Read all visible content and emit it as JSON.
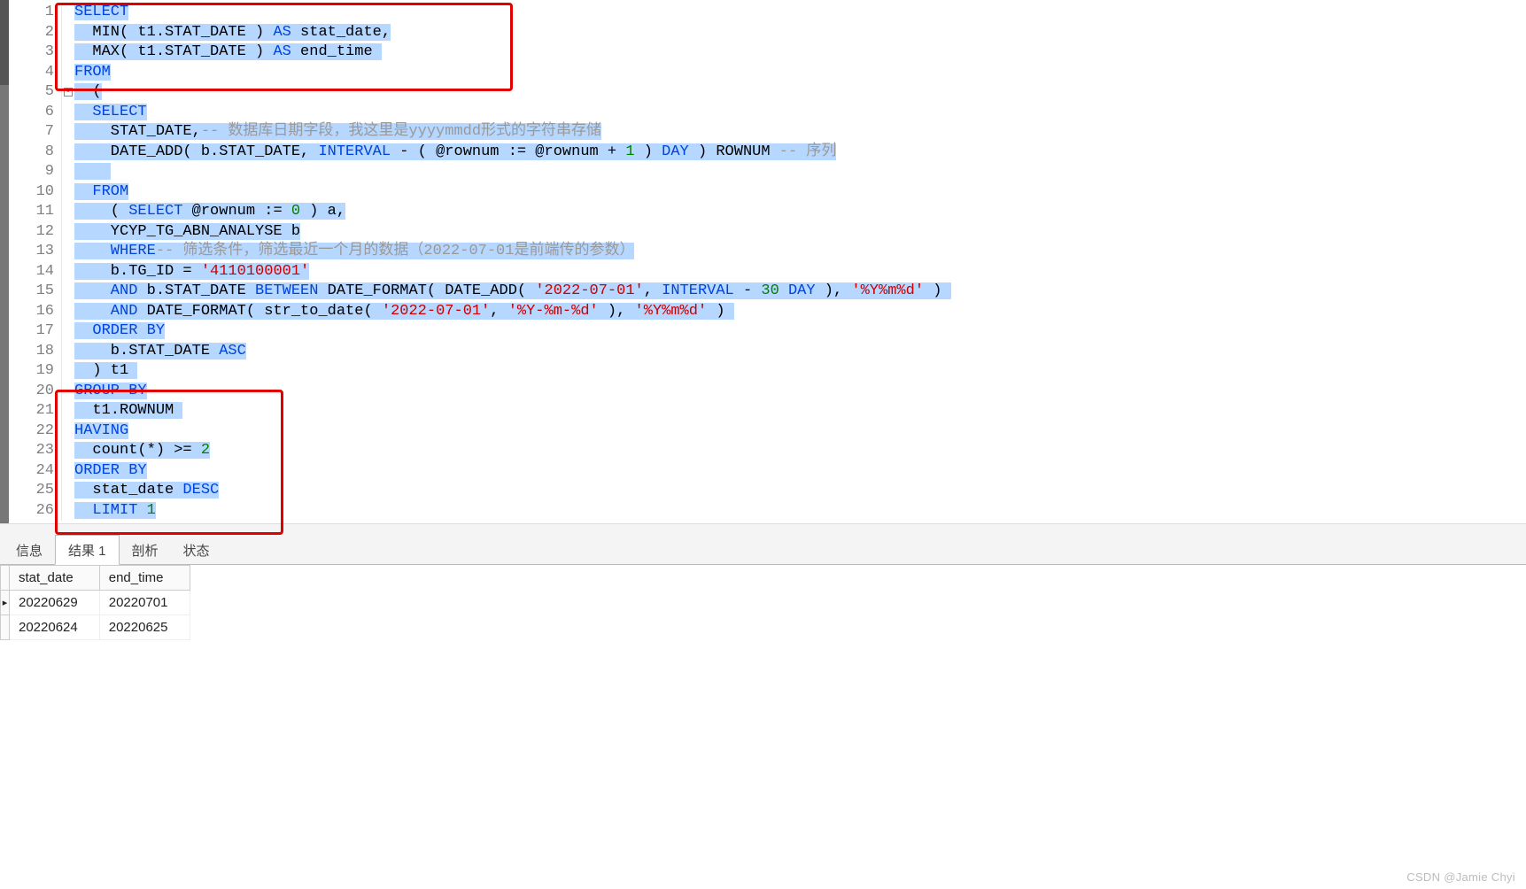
{
  "code": {
    "lines": [
      1,
      2,
      3,
      4,
      5,
      6,
      7,
      8,
      9,
      10,
      11,
      12,
      13,
      14,
      15,
      16,
      17,
      18,
      19,
      20,
      21,
      22,
      23,
      24,
      25,
      26
    ],
    "l1_k": "SELECT",
    "l2_p1": "  MIN( t1.STAT_DATE ) ",
    "l2_k": "AS",
    "l2_p2": " stat_date,",
    "l3_p1": "  MAX( t1.STAT_DATE ) ",
    "l3_k": "AS",
    "l3_p2": " end_time ",
    "l4_k": "FROM",
    "l5_p": "  (",
    "l6_k": "  SELECT",
    "l7_p1": "    STAT_DATE,",
    "l7_cm": "-- 数据库日期字段，我这里是yyyymmdd形式的字符串存储",
    "l8_p1": "    DATE_ADD( b.STAT_DATE, ",
    "l8_k1": "INTERVAL",
    "l8_p2": " - ( @rownum := @rownum + ",
    "l8_n1": "1",
    "l8_p3": " ) ",
    "l8_k2": "DAY",
    "l8_p4": " ) ROWNUM ",
    "l8_cm": "-- 序列",
    "l9_p": "    ",
    "l10_k": "  FROM",
    "l11_p1": "    ( ",
    "l11_k": "SELECT",
    "l11_p2": " @rownum := ",
    "l11_n": "0",
    "l11_p3": " ) a,",
    "l12_p": "    YCYP_TG_ABN_ANALYSE b",
    "l13_k": "    WHERE",
    "l13_cm": "-- 筛选条件，筛选最近一个月的数据（2022-07-01是前端传的参数）",
    "l14_p1": "    b.TG_ID = ",
    "l14_s": "'4110100001'",
    "l15_k1": "    AND",
    "l15_p1": " b.STAT_DATE ",
    "l15_k2": "BETWEEN",
    "l15_p2": " DATE_FORMAT( DATE_ADD( ",
    "l15_s1": "'2022-07-01'",
    "l15_p3": ", ",
    "l15_k3": "INTERVAL",
    "l15_p4": " - ",
    "l15_n": "30",
    "l15_k4": " DAY",
    "l15_p5": " ), ",
    "l15_s2": "'%Y%m%d'",
    "l15_p6": " ) ",
    "l16_k1": "    AND",
    "l16_p1": " DATE_FORMAT( str_to_date( ",
    "l16_s1": "'2022-07-01'",
    "l16_p2": ", ",
    "l16_s2": "'%Y-%m-%d'",
    "l16_p3": " ), ",
    "l16_s3": "'%Y%m%d'",
    "l16_p4": " ) ",
    "l17_k": "  ORDER BY",
    "l18_p1": "    b.STAT_DATE ",
    "l18_k": "ASC",
    "l19_p": "  ) t1 ",
    "l20_k": "GROUP BY",
    "l21_p": "  t1.ROWNUM ",
    "l22_k": "HAVING",
    "l23_p1": "  count(*) >= ",
    "l23_n": "2",
    "l24_k": "ORDER BY",
    "l25_p1": "  stat_date ",
    "l25_k": "DESC",
    "l26_k1": "  LIMIT",
    "l26_p": " ",
    "l26_n": "1"
  },
  "tabs": {
    "info": "信息",
    "result": "结果 1",
    "profile": "剖析",
    "status": "状态"
  },
  "results": {
    "headers": {
      "c0": "stat_date",
      "c1": "end_time"
    },
    "rows": [
      {
        "c0": "20220629",
        "c1": "20220701"
      },
      {
        "c0": "20220624",
        "c1": "20220625"
      }
    ]
  },
  "watermark": "CSDN @Jamie Chyi"
}
